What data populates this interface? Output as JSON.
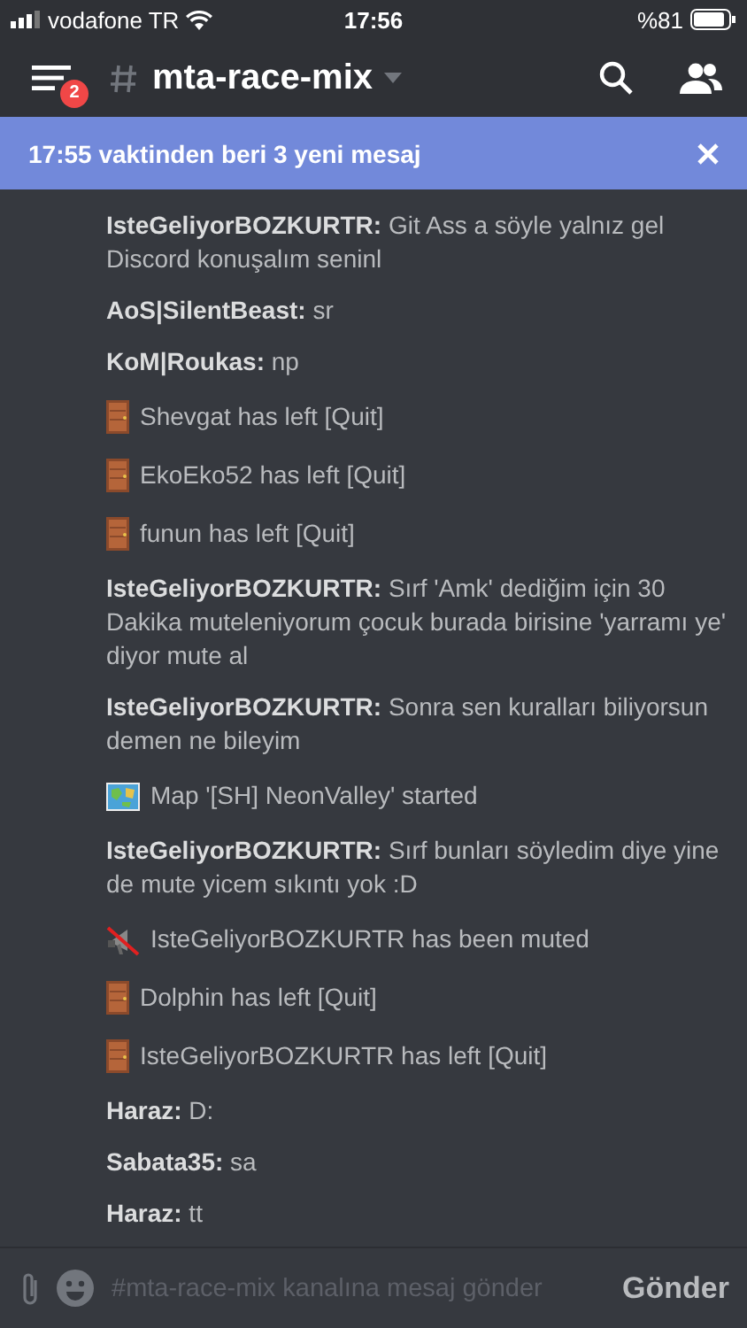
{
  "status_bar": {
    "carrier": "vodafone TR",
    "time": "17:56",
    "battery": "%81"
  },
  "header": {
    "unread_badge": "2",
    "channel": "mta-race-mix"
  },
  "new_messages_banner": {
    "text": "17:55 vaktinden beri 3 yeni mesaj"
  },
  "messages": [
    {
      "kind": "chat",
      "author": "IsteGeliyorBOZKURTR:",
      "text": "Git Ass a söyle yalnız gel Discord konuşalım seninl"
    },
    {
      "kind": "chat",
      "author": "AoS|SilentBeast:",
      "text": "sr"
    },
    {
      "kind": "chat",
      "author": "KoM|Roukas:",
      "text": "np"
    },
    {
      "kind": "leave",
      "text": "Shevgat has left [Quit]"
    },
    {
      "kind": "leave",
      "text": "EkoEko52 has left [Quit]"
    },
    {
      "kind": "leave",
      "text": "funun has left [Quit]"
    },
    {
      "kind": "chat",
      "author": "IsteGeliyorBOZKURTR:",
      "text": "Sırf 'Amk' dediğim için 30 Dakika muteleniyorum çocuk burada birisine 'yarramı ye' diyor mute al"
    },
    {
      "kind": "chat",
      "author": "IsteGeliyorBOZKURTR:",
      "text": "Sonra sen kuralları biliyorsun demen ne bileyim"
    },
    {
      "kind": "map",
      "text": "Map '[SH] NeonValley' started"
    },
    {
      "kind": "chat",
      "author": "IsteGeliyorBOZKURTR:",
      "text": "Sırf bunları söyledim diye yine de mute yicem sıkıntı yok :D"
    },
    {
      "kind": "mute",
      "text": "IsteGeliyorBOZKURTR has been muted"
    },
    {
      "kind": "leave",
      "text": "Dolphin has left [Quit]"
    },
    {
      "kind": "leave",
      "text": "IsteGeliyorBOZKURTR has left [Quit]"
    },
    {
      "kind": "chat",
      "author": "Haraz:",
      "text": "D:"
    },
    {
      "kind": "chat",
      "author": "Sabata35:",
      "text": "sa"
    },
    {
      "kind": "chat",
      "author": "Haraz:",
      "text": "tt"
    }
  ],
  "composer": {
    "placeholder": "#mta-race-mix kanalına mesaj gönder",
    "send_button": "Gönder"
  }
}
